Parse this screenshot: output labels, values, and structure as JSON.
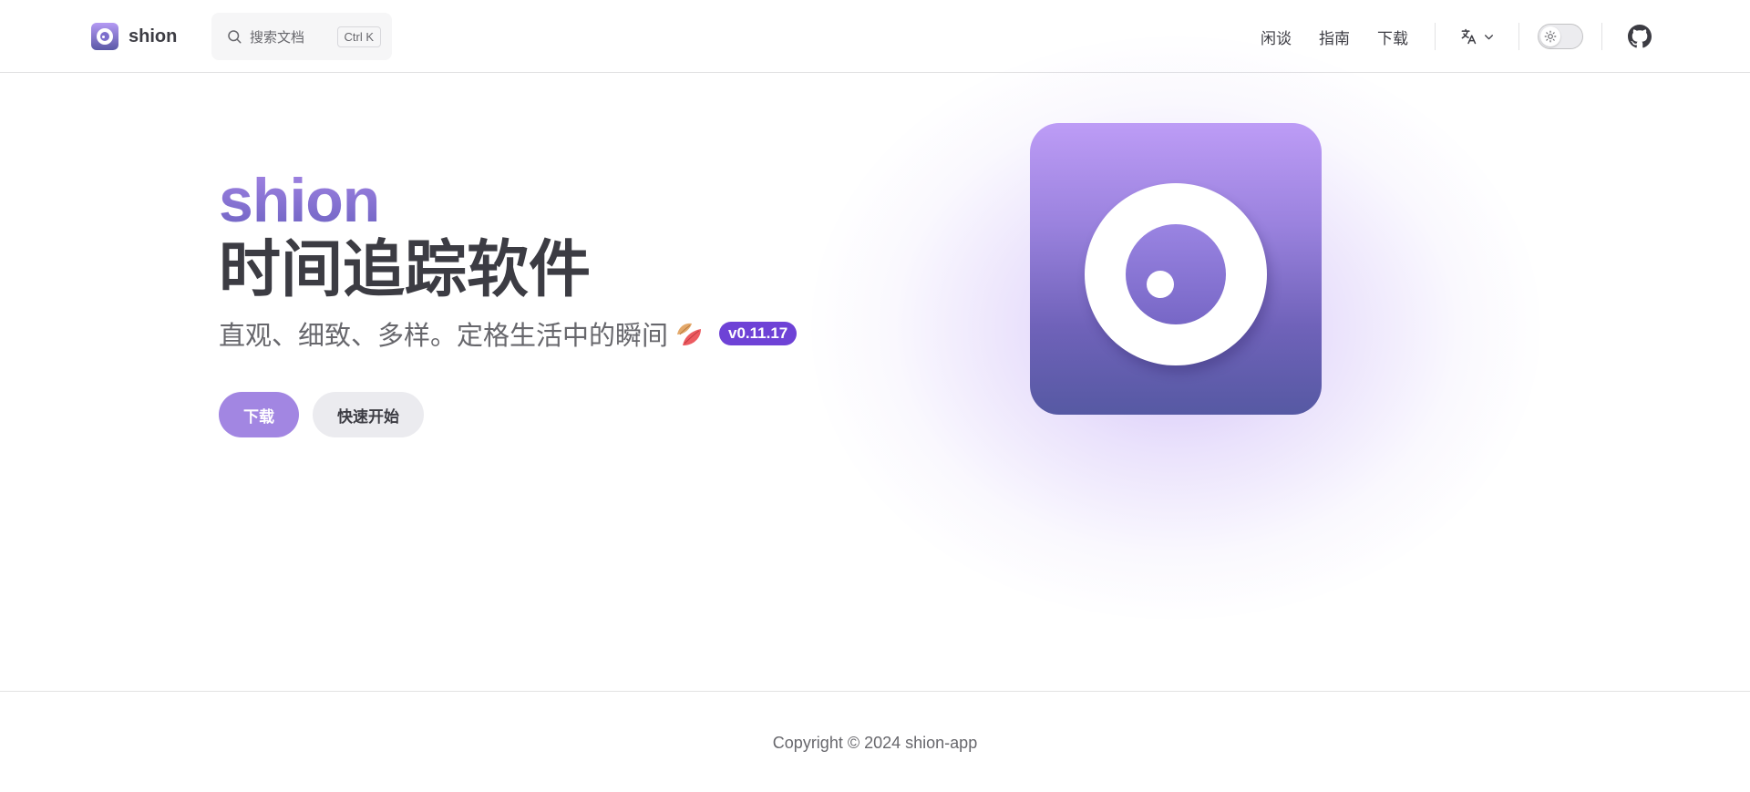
{
  "nav": {
    "brand_name": "shion",
    "search": {
      "placeholder": "搜索文档",
      "shortcut": "Ctrl K"
    },
    "links": [
      {
        "label": "闲谈"
      },
      {
        "label": "指南"
      },
      {
        "label": "下载"
      }
    ],
    "icons": {
      "search": "search-icon",
      "language": "translate-icon",
      "dropdown": "chevron-down-icon",
      "theme": "sun-icon",
      "github": "github-icon"
    },
    "theme_mode": "light"
  },
  "hero": {
    "name": "shion",
    "title": "时间追踪软件",
    "tagline": "直观、细致、多样。定格生活中的瞬间",
    "version": "v0.11.17",
    "actions": {
      "primary_label": "下载",
      "secondary_label": "快速开始"
    }
  },
  "footer": {
    "copyright": "Copyright © 2024 shion-app"
  },
  "colors": {
    "brand_purple": "#a286e2",
    "badge_purple": "#6e42d6",
    "text": "#3c3c43",
    "muted": "#67676c"
  }
}
